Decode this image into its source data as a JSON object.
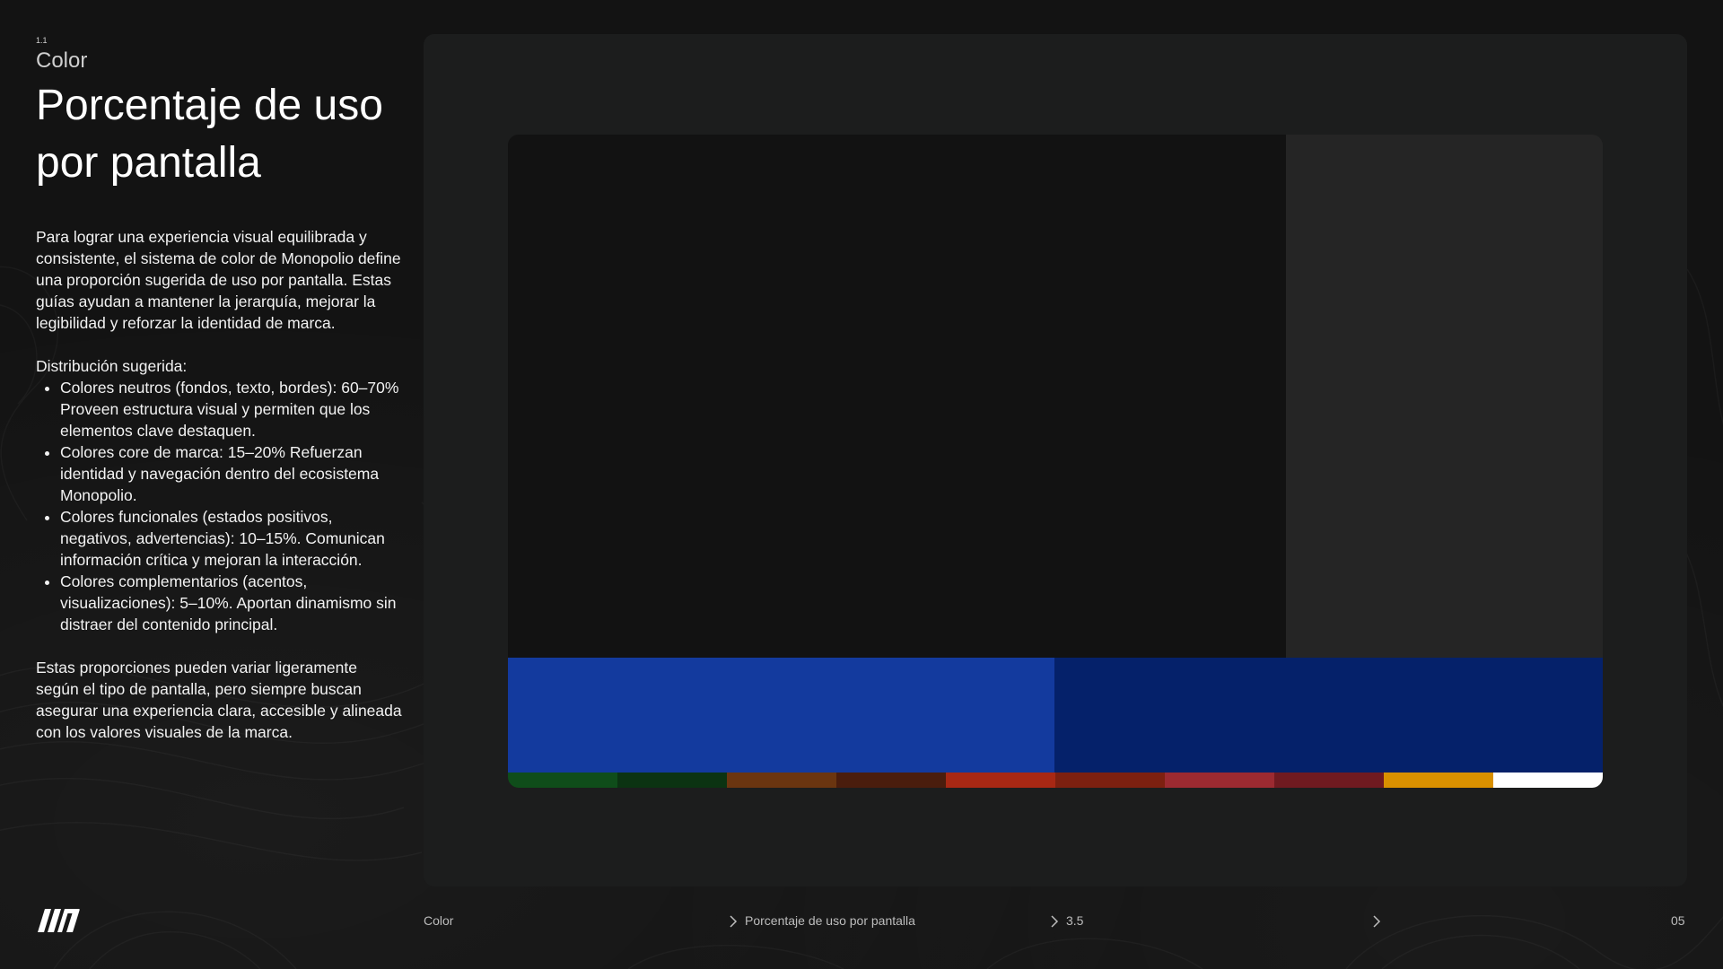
{
  "section": {
    "number": "1.1",
    "name": "Color"
  },
  "title": "Porcentaje de uso por pantalla",
  "intro": "Para lograr una experiencia visual equilibrada y consistente, el sistema de color de Monopolio define una proporción sugerida de uso por pantalla. Estas guías ayudan a mantener la jerarquía, mejorar la legibilidad y reforzar la identidad de marca.",
  "distribution_heading": "Distribución sugerida:",
  "distribution": [
    "Colores neutros (fondos, texto, bordes): 60–70% Proveen estructura visual y permiten que los elementos clave destaquen.",
    "Colores core de marca: 15–20% Refuerzan identidad y navegación dentro del ecosistema Monopolio.",
    "Colores funcionales (estados positivos, negativos, advertencias): 10–15%. Comunican información crítica y mejoran la interacción.",
    "Colores complementarios (acentos, visualizaciones): 5–10%. Aportan dinamismo sin distraer del contenido principal."
  ],
  "closing": "Estas proporciones pueden variar ligeramente según el tipo de pantalla, pero siempre buscan asegurar una experiencia clara, accesible y alineada con los valores visuales de la marca.",
  "colors": {
    "neutral_dark": "#121212",
    "neutral_light": "#252525",
    "core_primary": "#133a9e",
    "core_dark": "#05216a",
    "swatches": [
      "#0f4d1a",
      "#0b3312",
      "#6b3510",
      "#4a1d0d",
      "#a82814",
      "#7d2010",
      "#9c2a31",
      "#701a20",
      "#d99000",
      "#ffffff"
    ]
  },
  "footer": {
    "crumb_1": "Color",
    "crumb_2": "Porcentaje de uso por pantalla",
    "crumb_3": "3.5",
    "page_number": "05"
  },
  "icons": {
    "logo": "monopolio-logo",
    "separator": "chevron-right-icon"
  }
}
